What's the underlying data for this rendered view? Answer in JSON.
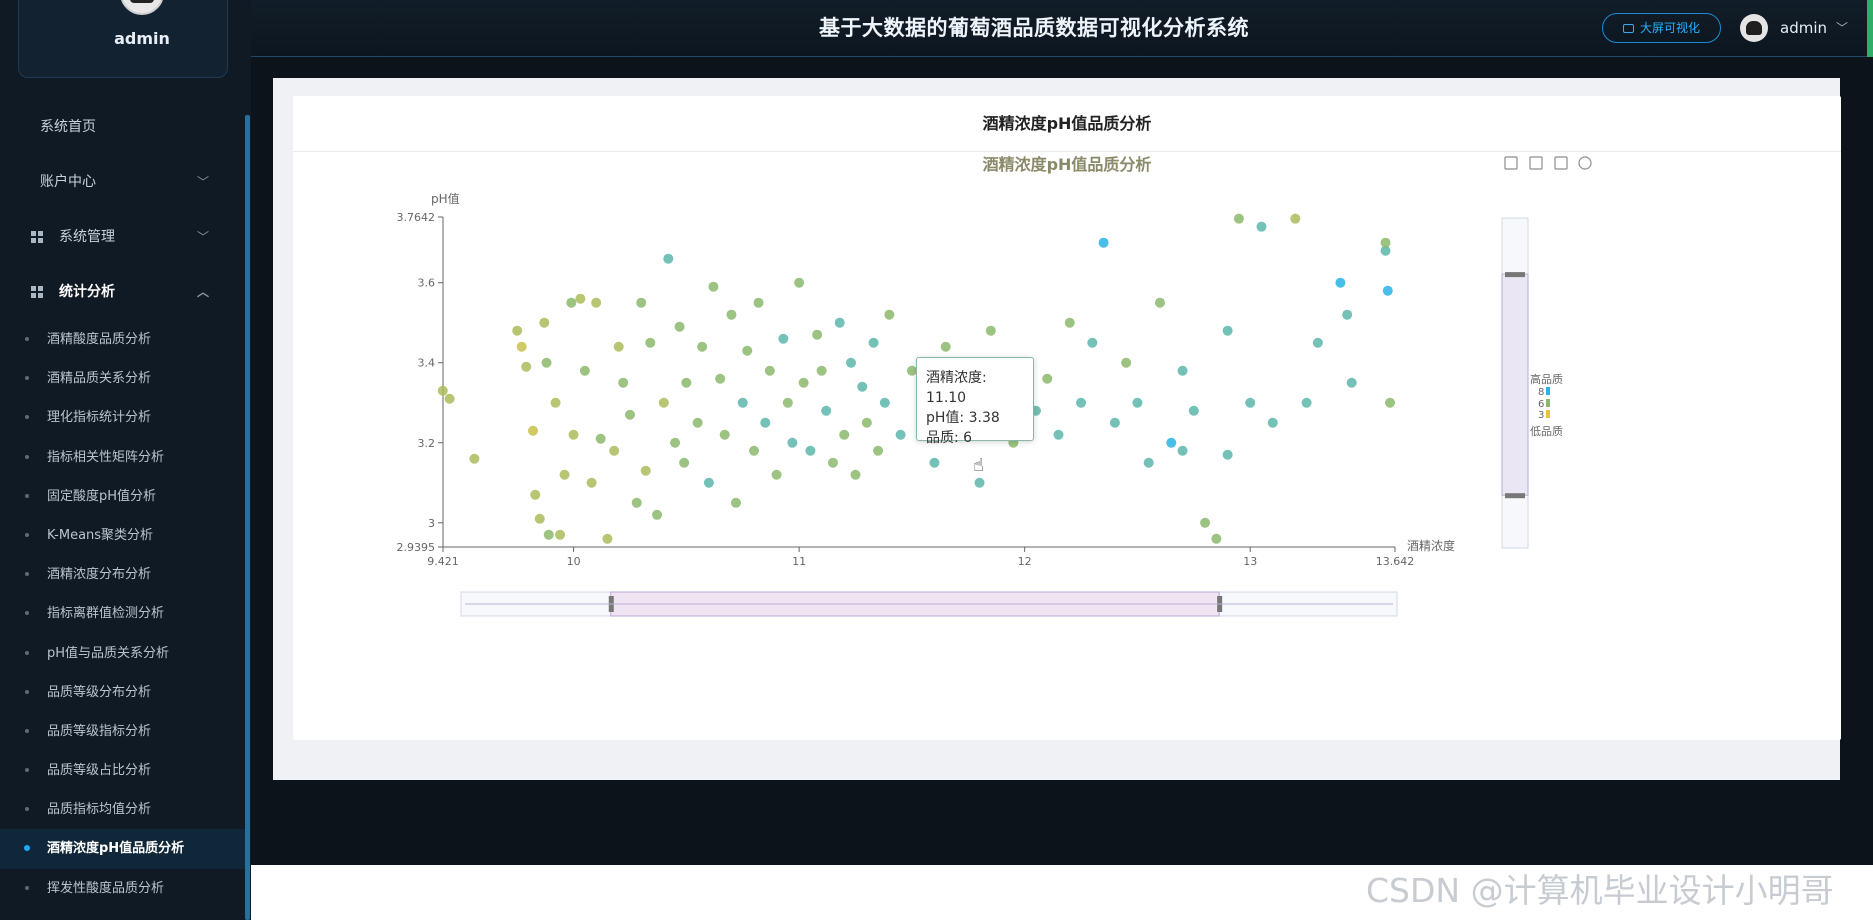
{
  "sidebar": {
    "username": "admin",
    "items": [
      {
        "label": "系统首页"
      },
      {
        "label": "账户中心"
      },
      {
        "label": "系统管理"
      },
      {
        "label": "统计分析"
      }
    ],
    "submenu": [
      "酒精酸度品质分析",
      "酒精品质关系分析",
      "理化指标统计分析",
      "指标相关性矩阵分析",
      "固定酸度pH值分析",
      "K-Means聚类分析",
      "酒精浓度分布分析",
      "指标离群值检测分析",
      "pH值与品质关系分析",
      "品质等级分布分析",
      "品质等级指标分析",
      "品质等级占比分析",
      "品质指标均值分析",
      "酒精浓度pH值品质分析",
      "挥发性酸度品质分析"
    ],
    "active_index": 13
  },
  "header": {
    "title": "基于大数据的葡萄酒品质数据可视化分析系统",
    "bigscreen_label": "大屏可视化",
    "user": "admin"
  },
  "card": {
    "title": "酒精浓度pH值品质分析"
  },
  "tooltip": {
    "line1": "酒精浓度: 11.10",
    "line2": "pH值: 3.38",
    "line3": "品质: 6"
  },
  "watermark": "CSDN @计算机毕业设计小明哥",
  "colors": {
    "low": "#e6c33a",
    "mid": "#8cb96c",
    "high": "#2ab3e8",
    "accent": "#1ea7ff"
  },
  "chart_data": {
    "type": "scatter",
    "title": "酒精浓度pH值品质分析",
    "xlabel": "酒精浓度",
    "ylabel": "pH值",
    "xlim": [
      9.421,
      13.642
    ],
    "ylim": [
      2.9395,
      3.7642
    ],
    "x_ticks": [
      "9.421",
      "10",
      "11",
      "12",
      "13",
      "13.642"
    ],
    "y_ticks": [
      "2.9395",
      "3",
      "3.2",
      "3.4",
      "3.6",
      "3.7642"
    ],
    "visual_map": {
      "top_label": "高品质",
      "bottom_label": "低品质",
      "max": 8,
      "mid": 6,
      "min": 3
    },
    "data_zoom": {
      "x_start": 0.16,
      "x_end": 0.81,
      "y_start": 0.17,
      "y_end": 0.84
    },
    "toolbox": [
      "download-icon",
      "zoom-icon",
      "zoom-reset-icon",
      "restore-icon"
    ],
    "points": [
      [
        9.42,
        3.33,
        5
      ],
      [
        9.45,
        3.31,
        5
      ],
      [
        9.56,
        3.16,
        5
      ],
      [
        9.75,
        3.48,
        5
      ],
      [
        9.77,
        3.44,
        4
      ],
      [
        9.79,
        3.39,
        5
      ],
      [
        9.82,
        3.23,
        4
      ],
      [
        9.83,
        3.07,
        5
      ],
      [
        9.85,
        3.01,
        5
      ],
      [
        9.87,
        3.5,
        5
      ],
      [
        9.88,
        3.4,
        6
      ],
      [
        9.89,
        2.97,
        6
      ],
      [
        9.92,
        3.3,
        5
      ],
      [
        9.94,
        2.97,
        5
      ],
      [
        9.96,
        3.12,
        5
      ],
      [
        9.99,
        3.55,
        6
      ],
      [
        10.0,
        3.22,
        5
      ],
      [
        10.03,
        3.56,
        5
      ],
      [
        10.05,
        3.38,
        6
      ],
      [
        10.08,
        3.1,
        5
      ],
      [
        10.1,
        3.55,
        5
      ],
      [
        10.12,
        3.21,
        6
      ],
      [
        10.15,
        2.96,
        5
      ],
      [
        10.18,
        3.18,
        5
      ],
      [
        10.2,
        3.44,
        5
      ],
      [
        10.22,
        3.35,
        6
      ],
      [
        10.25,
        3.27,
        6
      ],
      [
        10.28,
        3.05,
        6
      ],
      [
        10.3,
        3.55,
        6
      ],
      [
        10.32,
        3.13,
        5
      ],
      [
        10.34,
        3.45,
        6
      ],
      [
        10.37,
        3.02,
        6
      ],
      [
        10.4,
        3.3,
        5
      ],
      [
        10.42,
        3.66,
        7
      ],
      [
        10.45,
        3.2,
        6
      ],
      [
        10.47,
        3.49,
        6
      ],
      [
        10.49,
        3.15,
        6
      ],
      [
        10.5,
        3.35,
        6
      ],
      [
        10.55,
        3.25,
        6
      ],
      [
        10.57,
        3.44,
        6
      ],
      [
        10.6,
        3.1,
        7
      ],
      [
        10.62,
        3.59,
        6
      ],
      [
        10.65,
        3.36,
        6
      ],
      [
        10.67,
        3.22,
        6
      ],
      [
        10.7,
        3.52,
        6
      ],
      [
        10.72,
        3.05,
        6
      ],
      [
        10.75,
        3.3,
        7
      ],
      [
        10.77,
        3.43,
        6
      ],
      [
        10.8,
        3.18,
        6
      ],
      [
        10.82,
        3.55,
        6
      ],
      [
        10.85,
        3.25,
        7
      ],
      [
        10.87,
        3.38,
        6
      ],
      [
        10.9,
        3.12,
        6
      ],
      [
        10.93,
        3.46,
        7
      ],
      [
        10.95,
        3.3,
        6
      ],
      [
        10.97,
        3.2,
        7
      ],
      [
        11.0,
        3.6,
        6
      ],
      [
        11.02,
        3.35,
        6
      ],
      [
        11.05,
        3.18,
        7
      ],
      [
        11.08,
        3.47,
        6
      ],
      [
        11.1,
        3.38,
        6
      ],
      [
        11.12,
        3.28,
        7
      ],
      [
        11.15,
        3.15,
        6
      ],
      [
        11.18,
        3.5,
        7
      ],
      [
        11.2,
        3.22,
        6
      ],
      [
        11.23,
        3.4,
        7
      ],
      [
        11.25,
        3.12,
        6
      ],
      [
        11.28,
        3.34,
        7
      ],
      [
        11.3,
        3.25,
        6
      ],
      [
        11.33,
        3.45,
        7
      ],
      [
        11.35,
        3.18,
        6
      ],
      [
        11.38,
        3.3,
        7
      ],
      [
        11.4,
        3.52,
        6
      ],
      [
        11.45,
        3.22,
        7
      ],
      [
        11.5,
        3.38,
        6
      ],
      [
        11.55,
        3.28,
        7
      ],
      [
        11.6,
        3.15,
        7
      ],
      [
        11.65,
        3.44,
        6
      ],
      [
        11.7,
        3.24,
        7
      ],
      [
        11.75,
        3.35,
        7
      ],
      [
        11.8,
        3.1,
        7
      ],
      [
        11.85,
        3.48,
        6
      ],
      [
        11.9,
        3.3,
        7
      ],
      [
        11.95,
        3.2,
        6
      ],
      [
        12.0,
        3.4,
        7
      ],
      [
        12.05,
        3.28,
        7
      ],
      [
        12.1,
        3.36,
        6
      ],
      [
        12.15,
        3.22,
        7
      ],
      [
        12.2,
        3.5,
        6
      ],
      [
        12.25,
        3.3,
        7
      ],
      [
        12.3,
        3.45,
        7
      ],
      [
        12.35,
        3.7,
        8
      ],
      [
        12.4,
        3.25,
        7
      ],
      [
        12.45,
        3.4,
        6
      ],
      [
        12.5,
        3.3,
        7
      ],
      [
        12.55,
        3.15,
        7
      ],
      [
        12.6,
        3.55,
        6
      ],
      [
        12.65,
        3.2,
        8
      ],
      [
        12.7,
        3.38,
        7
      ],
      [
        12.75,
        3.28,
        7
      ],
      [
        12.8,
        3.0,
        6
      ],
      [
        12.85,
        2.96,
        6
      ],
      [
        12.9,
        3.48,
        7
      ],
      [
        12.95,
        3.76,
        6
      ],
      [
        13.0,
        3.3,
        7
      ],
      [
        13.05,
        3.74,
        7
      ],
      [
        13.1,
        3.25,
        7
      ],
      [
        13.2,
        3.76,
        5
      ],
      [
        13.25,
        3.3,
        7
      ],
      [
        13.3,
        3.45,
        7
      ],
      [
        13.4,
        3.6,
        8
      ],
      [
        13.43,
        3.52,
        7
      ],
      [
        13.45,
        3.35,
        7
      ],
      [
        13.6,
        3.68,
        7
      ],
      [
        13.61,
        3.58,
        8
      ],
      [
        13.62,
        3.3,
        6
      ],
      [
        13.6,
        3.7,
        6
      ],
      [
        12.7,
        3.18,
        7
      ],
      [
        12.9,
        3.17,
        7
      ]
    ]
  }
}
